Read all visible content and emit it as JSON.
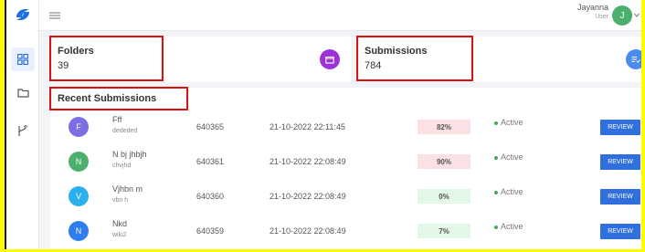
{
  "topbar": {
    "user_name": "Jayanna",
    "user_role": "User",
    "avatar_letter": "J"
  },
  "cards": {
    "folders": {
      "title": "Folders",
      "value": "39"
    },
    "submissions": {
      "title": "Submissions",
      "value": "784"
    }
  },
  "recent": {
    "title": "Recent Submissions",
    "rows": [
      {
        "letter": "F",
        "name": "Fff",
        "sub": "dededed",
        "id": "640365",
        "date": "21-10-2022 22:11:45",
        "pct": "82%",
        "status": "Active",
        "action": "REVIEW"
      },
      {
        "letter": "N",
        "name": "N bj jhbjh",
        "sub": "chvjhd",
        "id": "640361",
        "date": "21-10-2022 22:08:49",
        "pct": "90%",
        "status": "Active",
        "action": "REVIEW"
      },
      {
        "letter": "V",
        "name": "Vjhbn m",
        "sub": "vbn h",
        "id": "640360",
        "date": "21-10-2022 22:08:49",
        "pct": "0%",
        "status": "Active",
        "action": "REVIEW"
      },
      {
        "letter": "N",
        "name": "Nkd",
        "sub": "wiki2",
        "id": "640359",
        "date": "21-10-2022 22:08:49",
        "pct": "7%",
        "status": "Active",
        "action": "REVIEW"
      }
    ]
  },
  "colors": {
    "avatar_purple": "#7e6ee6",
    "avatar_green": "#4caf6e",
    "avatar_cyan": "#2ab0ee",
    "avatar_blue": "#2f7ef0",
    "pct_red_bg": "#fbe1e3",
    "pct_green_bg": "#e2f7e6",
    "accent": "#2f6fde",
    "highlight": "#e01010"
  },
  "icons": [
    "logo-icon",
    "menu-icon",
    "dashboard-icon",
    "folder-icon",
    "branch-icon",
    "folder-card-icon",
    "checklist-icon",
    "chevron-down-icon"
  ]
}
